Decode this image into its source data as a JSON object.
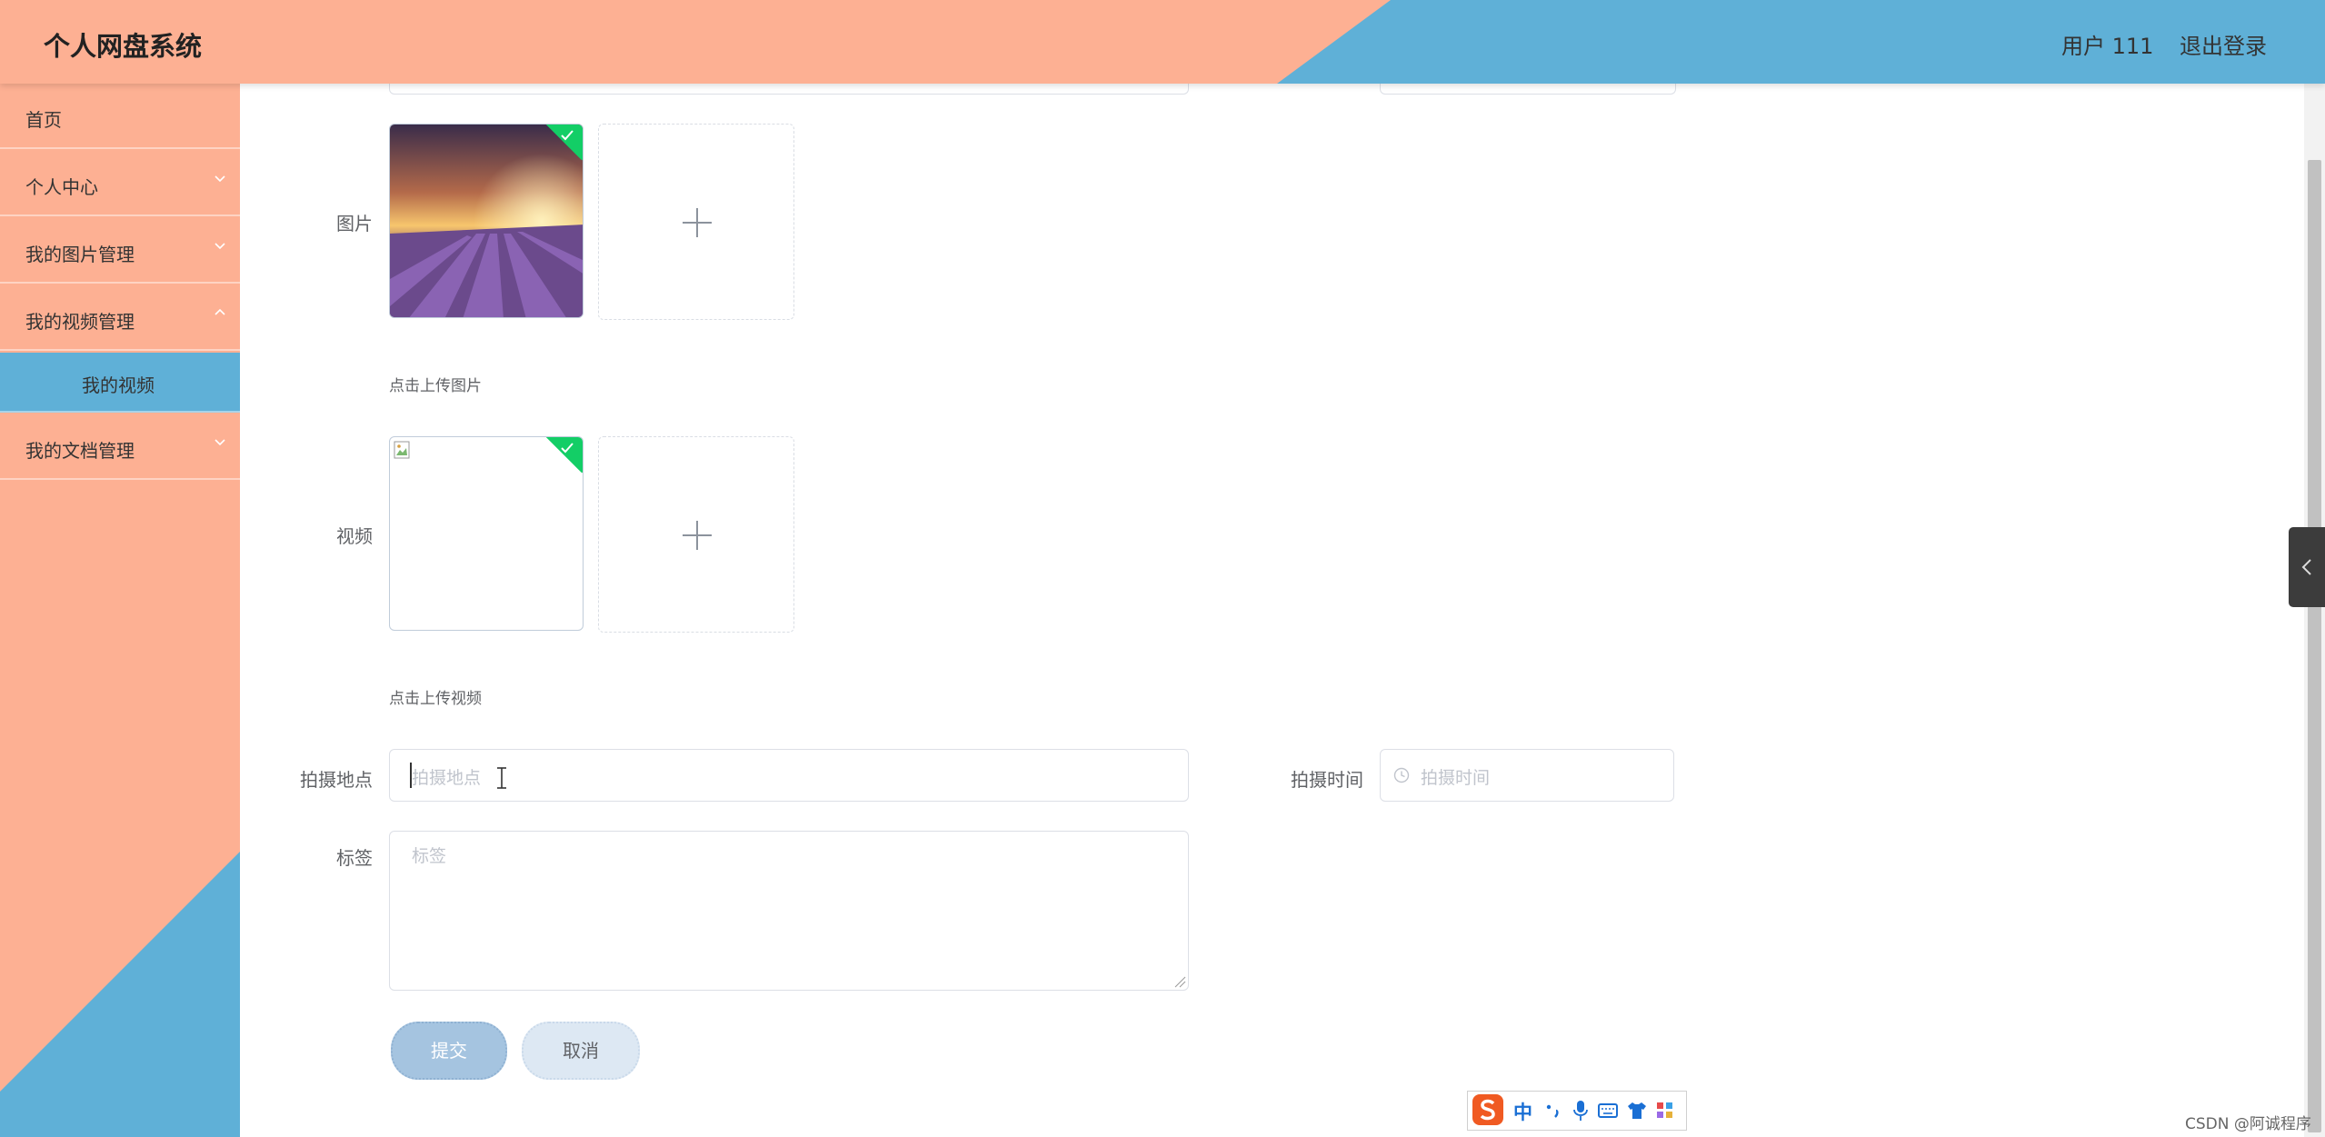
{
  "header": {
    "app_title": "个人网盘系统",
    "user_label": "用户 111",
    "logout_label": "退出登录"
  },
  "sidebar": {
    "items": [
      {
        "label": "首页",
        "has_chevron": false
      },
      {
        "label": "个人中心",
        "has_chevron": true
      },
      {
        "label": "我的图片管理",
        "has_chevron": true
      },
      {
        "label": "我的视频管理",
        "has_chevron": true,
        "expanded": true
      },
      {
        "label": "我的视频",
        "submenu": true,
        "active": true
      },
      {
        "label": "我的文档管理",
        "has_chevron": true
      }
    ]
  },
  "form": {
    "image_label": "图片",
    "image_tip": "点击上传图片",
    "video_label": "视频",
    "video_tip": "点击上传视频",
    "location_label": "拍摄地点",
    "location_placeholder": "拍摄地点",
    "time_label": "拍摄时间",
    "time_placeholder": "拍摄时间",
    "tags_label": "标签",
    "tags_placeholder": "标签",
    "submit_label": "提交",
    "cancel_label": "取消"
  },
  "ime_toolbar": {
    "mode_label": "中"
  },
  "watermark": "CSDN @阿诚程序",
  "colors": {
    "peach": "#fdb093",
    "blue": "#5fb0d7",
    "success": "#13ce66",
    "submit_bg": "#a5c4e0",
    "cancel_bg": "#dde8f3"
  }
}
